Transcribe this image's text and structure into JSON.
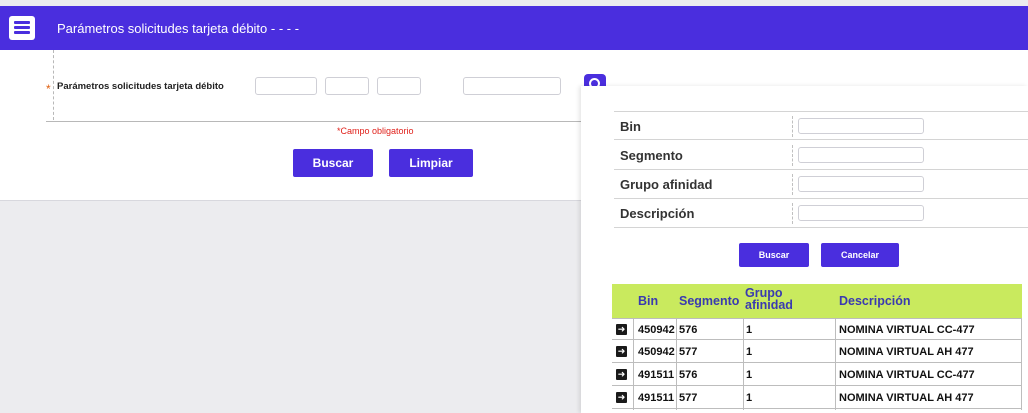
{
  "header": {
    "title": "Parámetros solicitudes tarjeta débito - - - -"
  },
  "form": {
    "required_marker": "*",
    "param_label": "Parámetros solicitudes tarjeta débito",
    "required_note": "*Campo obligatorio",
    "search_label": "Buscar",
    "clear_label": "Limpiar"
  },
  "popup": {
    "fields": [
      {
        "label": "Bin",
        "value": ""
      },
      {
        "label": "Segmento",
        "value": ""
      },
      {
        "label": "Grupo afinidad",
        "value": ""
      },
      {
        "label": "Descripción",
        "value": ""
      }
    ],
    "search_label": "Buscar",
    "cancel_label": "Cancelar",
    "table": {
      "columns": [
        "Bin",
        "Segmento",
        "Grupo afinidad",
        "Descripción"
      ],
      "rows": [
        {
          "bin": "450942",
          "segmento": "576",
          "grupo": "1",
          "descripcion": "NOMINA VIRTUAL CC-477"
        },
        {
          "bin": "450942",
          "segmento": "577",
          "grupo": "1",
          "descripcion": "NOMINA VIRTUAL AH 477"
        },
        {
          "bin": "491511",
          "segmento": "576",
          "grupo": "1",
          "descripcion": "NOMINA VIRTUAL CC-477"
        },
        {
          "bin": "491511",
          "segmento": "577",
          "grupo": "1",
          "descripcion": "NOMINA VIRTUAL AH 477"
        }
      ]
    }
  },
  "colors": {
    "brand": "#4a2ede",
    "table_header": "#c9ea5e",
    "required": "#e0201a"
  },
  "icons": {
    "header": "list-document-icon",
    "lookup": "search-icon",
    "row": "arrow-right-icon"
  }
}
